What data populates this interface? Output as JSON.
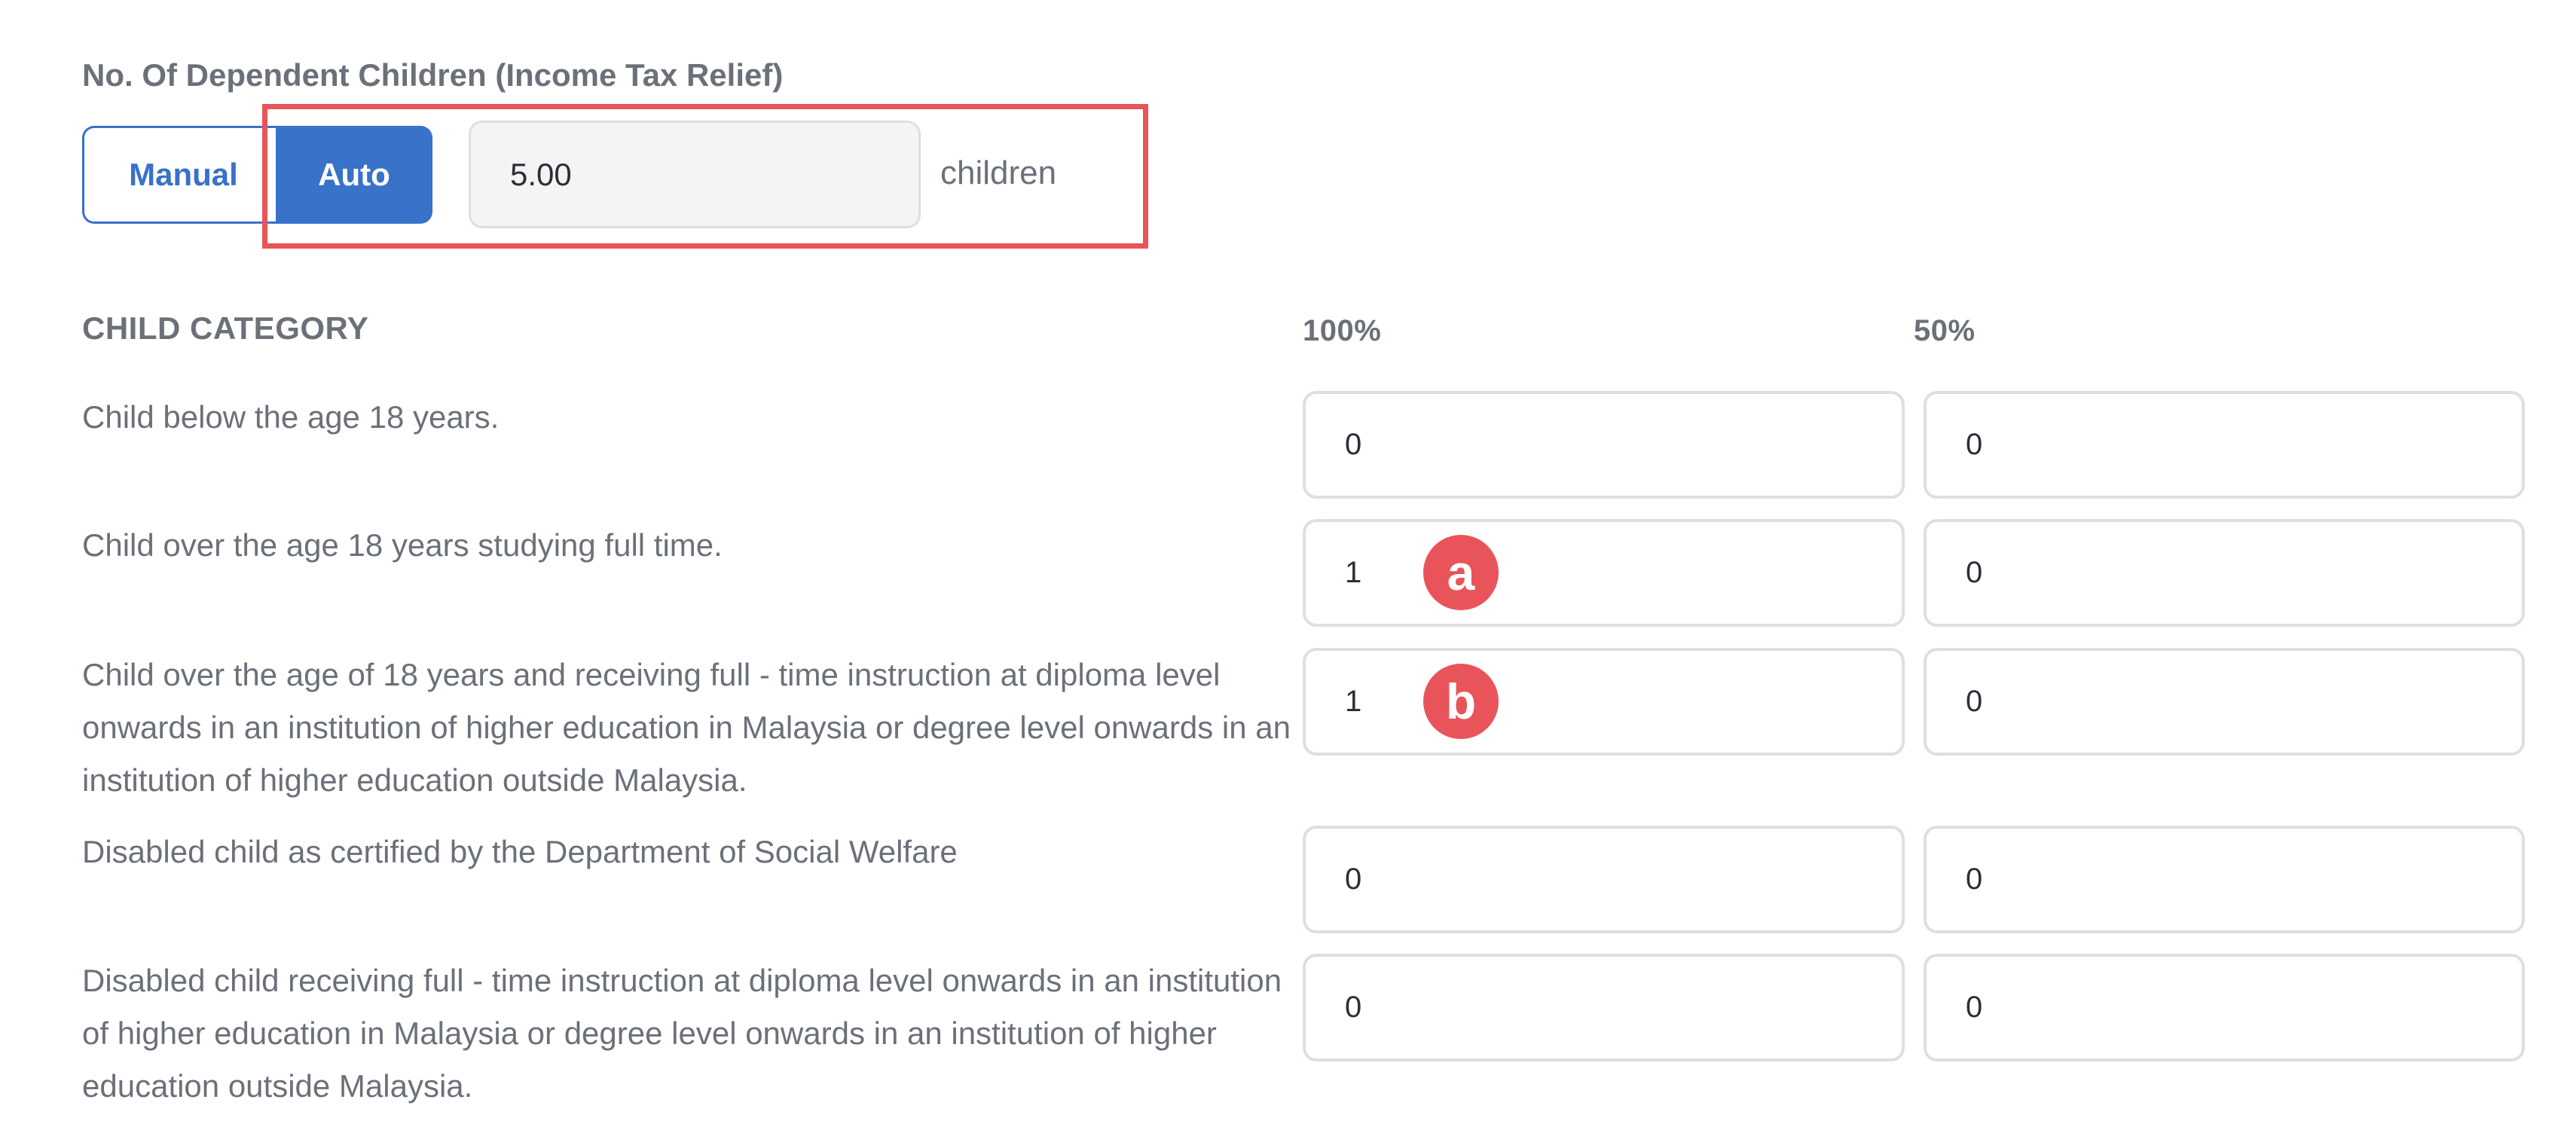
{
  "section_title": "No. Of Dependent Children (Income Tax Relief)",
  "toggle": {
    "manual_label": "Manual",
    "auto_label": "Auto",
    "selected": "Auto"
  },
  "children_count": {
    "value": "5.00",
    "unit": "children"
  },
  "table": {
    "headers": {
      "category": "CHILD CATEGORY",
      "full": "100%",
      "half": "50%"
    },
    "rows": [
      {
        "label": "Child below the age 18 years.",
        "full": "0",
        "half": "0"
      },
      {
        "label": "Child over the age 18 years studying full time.",
        "full": "1",
        "half": "0",
        "marker": "a"
      },
      {
        "label": "Child over the age of 18 years and receiving full - time instruction at diploma level onwards in an institution of higher education in Malaysia or degree level onwards in an institution of higher education outside Malaysia.",
        "full": "1",
        "half": "0",
        "marker": "b"
      },
      {
        "label": "Disabled child as certified by the Department of Social Welfare",
        "full": "0",
        "half": "0"
      },
      {
        "label": "Disabled child receiving full - time instruction at diploma level onwards in an institution of higher education in Malaysia or degree level onwards in an institution of higher education outside Malaysia.",
        "full": "0",
        "half": "0"
      }
    ]
  },
  "colors": {
    "accent": "#3872c9",
    "highlight": "#e9545a",
    "text": "#6b7079",
    "input_border": "#dcdfe4"
  }
}
